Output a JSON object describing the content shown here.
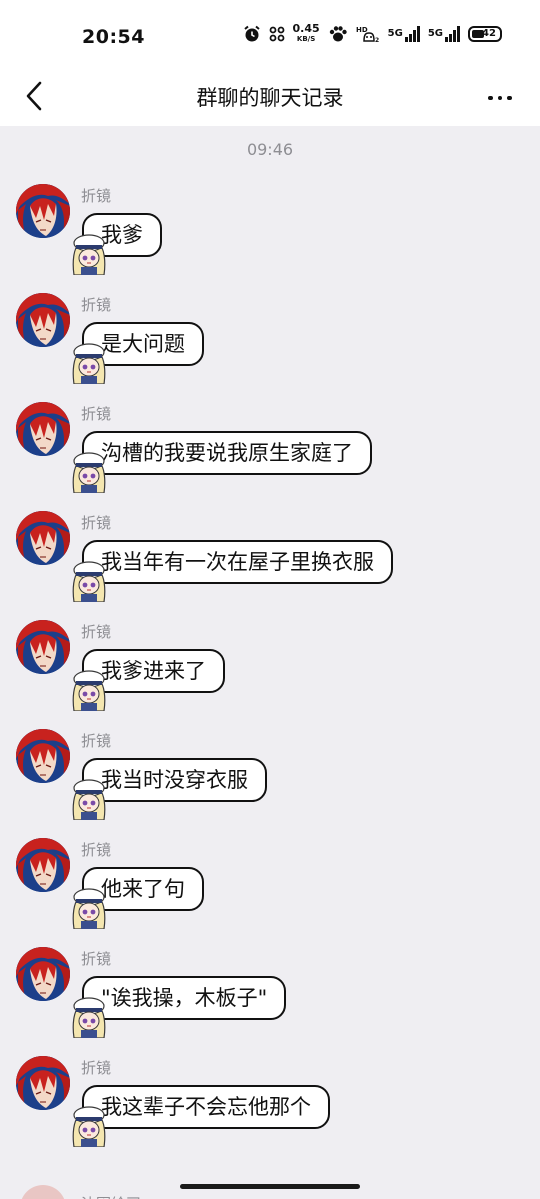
{
  "status_bar": {
    "time": "20:54",
    "net_speed_value": "0.45",
    "net_speed_unit": "KB/S",
    "network_1": "5G",
    "network_2": "5G",
    "battery": "42",
    "icons": [
      "alarm-icon",
      "bluetooth-icon",
      "netspeed-icon",
      "paw-icon",
      "hd-icon",
      "signal-5g-icon",
      "signal-5g-icon",
      "battery-icon"
    ]
  },
  "nav": {
    "title": "群聊的聊天记录",
    "back_icon": "chevron-left-icon",
    "more_icon": "more-horizontal-icon"
  },
  "chat": {
    "time_divider": "09:46",
    "messages": [
      {
        "sender": "折镜",
        "text": "我爹"
      },
      {
        "sender": "折镜",
        "text": "是大问题"
      },
      {
        "sender": "折镜",
        "text": "沟槽的我要说我原生家庭了"
      },
      {
        "sender": "折镜",
        "text": "我当年有一次在屋子里换衣服"
      },
      {
        "sender": "折镜",
        "text": "我爹进来了"
      },
      {
        "sender": "折镜",
        "text": "我当时没穿衣服"
      },
      {
        "sender": "折镜",
        "text": "他来了句"
      },
      {
        "sender": "折镜",
        "text": "\"诶我操，木板子\""
      },
      {
        "sender": "折镜",
        "text": "我这辈子不会忘他那个"
      }
    ],
    "cutoff_sender": "沈因绘司"
  },
  "colors": {
    "chat_bg": "#efeef2",
    "bubble_bg": "#ffffff",
    "bubble_border": "#111111",
    "meta_text": "#8e8e93",
    "avatar_hair": "#c8221e",
    "avatar_bg": "#1c3f8a"
  }
}
